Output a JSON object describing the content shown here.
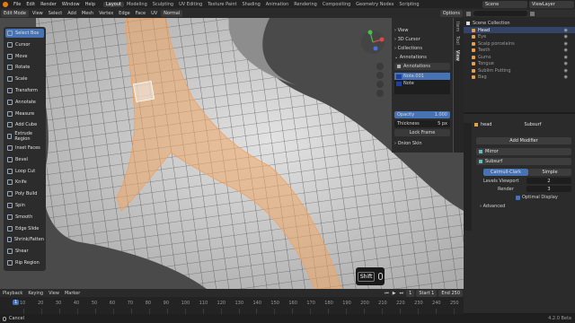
{
  "topbar": {
    "menus": [
      "File",
      "Edit",
      "Render",
      "Window",
      "Help"
    ],
    "workspaces": [
      "Layout",
      "Modeling",
      "Sculpting",
      "UV Editing",
      "Texture Paint",
      "Shading",
      "Animation",
      "Rendering",
      "Compositing",
      "Geometry Nodes",
      "Scripting"
    ],
    "active_workspace": "Layout",
    "scene_label": "Scene",
    "viewlayer_label": "ViewLayer"
  },
  "viewport_header": {
    "mode": "Edit Mode",
    "menus": [
      "View",
      "Select",
      "Add",
      "Mesh",
      "Vertex",
      "Edge",
      "Face",
      "UV"
    ],
    "orientation": "Normal",
    "options_label": "Options"
  },
  "tools": [
    {
      "label": "Select Box",
      "active": true
    },
    {
      "label": "Cursor",
      "active": false
    },
    {
      "label": "Move",
      "active": false
    },
    {
      "label": "Rotate",
      "active": false
    },
    {
      "label": "Scale",
      "active": false
    },
    {
      "label": "Transform",
      "active": false
    },
    {
      "label": "Annotate",
      "active": false
    },
    {
      "label": "Measure",
      "active": false
    },
    {
      "label": "Add Cube",
      "active": false
    },
    {
      "label": "Extrude Region",
      "active": false
    },
    {
      "label": "Inset Faces",
      "active": false
    },
    {
      "label": "Bevel",
      "active": false
    },
    {
      "label": "Loop Cut",
      "active": false
    },
    {
      "label": "Knife",
      "active": false
    },
    {
      "label": "Poly Build",
      "active": false
    },
    {
      "label": "Spin",
      "active": false
    },
    {
      "label": "Smooth",
      "active": false
    },
    {
      "label": "Edge Slide",
      "active": false
    },
    {
      "label": "Shrink/Fatten",
      "active": false
    },
    {
      "label": "Shear",
      "active": false
    },
    {
      "label": "Rip Region",
      "active": false
    }
  ],
  "npanel": {
    "sections": [
      "View",
      "3D Cursor",
      "Collections",
      "Annotations"
    ],
    "annotations_label": "Annotations",
    "layers": [
      "Note.001",
      "Note"
    ],
    "opacity_label": "Opacity",
    "opacity_value": "1.000",
    "thickness_label": "Thickness",
    "thickness_value": "5 px",
    "lock_frame": "Lock Frame",
    "onion_skin": "Onion Skin",
    "tabs": [
      "Item",
      "Tool",
      "View"
    ]
  },
  "outliner": {
    "title": "Scene Collection",
    "items": [
      "Head",
      "Eye",
      "Scalp porcelains",
      "Teeth",
      "Gums",
      "Tongue",
      "Sublim Putting",
      "Bag"
    ]
  },
  "properties": {
    "object_name": "head",
    "modifier_tab": "Subsurf",
    "add_modifier": "Add Modifier",
    "modifiers": [
      "Mirror",
      "Subsurf"
    ],
    "subsurf_types": [
      "Catmull-Clark",
      "Simple"
    ],
    "levels_viewport_label": "Levels Viewport",
    "levels_viewport": "2",
    "render_label": "Render",
    "render_value": "3",
    "optimal_display": "Optimal Display",
    "advanced": "Advanced"
  },
  "timeline": {
    "menus": [
      "Playback",
      "Keying",
      "View",
      "Marker"
    ],
    "current_frame": "1",
    "start_label": "Start",
    "start_value": "1",
    "end_label": "End",
    "end_value": "250",
    "frames": [
      "10",
      "20",
      "30",
      "40",
      "50",
      "60",
      "70",
      "80",
      "90",
      "100",
      "110",
      "120",
      "130",
      "140",
      "150",
      "160",
      "170",
      "180",
      "190",
      "200",
      "210",
      "220",
      "230",
      "240",
      "250"
    ]
  },
  "overlay": {
    "key_label": "Shift"
  },
  "status": {
    "left": "Cancel",
    "version": "4.2.0 Beta"
  },
  "colors": {
    "accent": "#4772b3",
    "selection": "#f0a060",
    "mesh": "#cfcfcf"
  }
}
